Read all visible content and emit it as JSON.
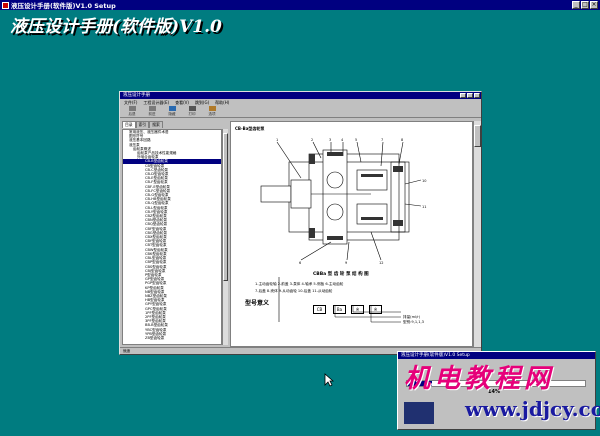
{
  "setup_window": {
    "title": "液压设计手册(软件版)V1.0 Setup",
    "banner": "液压设计手册(软件版)V1.0",
    "controls": {
      "minimize": "_",
      "maximize": "□",
      "close": "×"
    }
  },
  "help_window": {
    "title": "液压设计手册",
    "menu": [
      "文件(F)",
      "工程设计器(E)",
      "查看(V)",
      "跳到(G)",
      "帮助(H)"
    ],
    "toolbar": [
      "后退",
      "前进",
      "隐藏",
      "打印",
      "选项"
    ],
    "tabs": [
      "目录",
      "索引",
      "搜索"
    ],
    "tree": [
      "常用液压、液压器件术语",
      "图形符号",
      "液压基本回路",
      "液压泵",
      "齿轮泵概述",
      "齿轮泵产品技术性能规格",
      "外啮合齿轮泵",
      "CB-B型齿轮泵",
      "CB型齿轮泵",
      "CB-C型齿轮泵",
      "CB-D型齿轮泵",
      "CB-E型齿轮泵",
      "CB-F型齿轮泵",
      "CBF-E型齿轮泵",
      "CB-FC型齿轮泵",
      "CB-G型齿轮泵",
      "CB-HB型齿轮泵",
      "CB-Q型齿轮泵",
      "CB-L型齿轮泵",
      "CB-Y型齿轮泵",
      "CBZ型齿轮泵",
      "CBN型齿轮泵",
      "CBQ型齿轮泵",
      "CBF型齿轮泵",
      "CBG型齿轮泵",
      "CBX型齿轮泵",
      "CBY型齿轮泵",
      "CBT型齿轮泵",
      "CBW型齿轮泵",
      "CBK型齿轮泵",
      "CBL型齿轮泵",
      "CBP型齿轮泵",
      "CBS型齿轮泵",
      "CBJ型齿轮泵",
      "P型齿轮泵",
      "GP型齿轮泵",
      "PGP型齿轮泵",
      "KP型齿轮泵",
      "NB型齿轮泵",
      "NBZ型齿轮泵",
      "HB型齿轮泵",
      "GPY型齿轮泵",
      "GPC型齿轮泵",
      "1PF型齿轮泵",
      "2PF型齿轮泵",
      "3PF型齿轮泵",
      "BB-B型齿轮泵",
      "YBC型齿轮泵",
      "YPB型齿轮泵",
      "ZB型齿轮泵"
    ],
    "content_heading": "CB-Ba型齿轮泵",
    "figure_caption": "CBBa 型 齿 轮 泵 结 构 图",
    "legend_line1": "1-主动齿轮轴   2-前盖   3-泵体   4-轴承   5-侧板   6-主动齿轮",
    "legend_line2": "7-后盖   8-壳体   9-从动齿轮   10-后盖   11-从动齿轮",
    "model_title": "型号意义",
    "model_boxes": [
      "CB",
      "Ba",
      "※",
      "※"
    ],
    "model_notes": [
      "排量(ml/r)",
      "型别:9,1,1,3"
    ],
    "status": "就绪"
  },
  "progress_window": {
    "title": "液压设计手册(软件版)V1.0 Setup",
    "percent": "14%"
  },
  "watermark": {
    "logo_text": "机电教程网",
    "url_text": "www.jdjcy.com"
  }
}
